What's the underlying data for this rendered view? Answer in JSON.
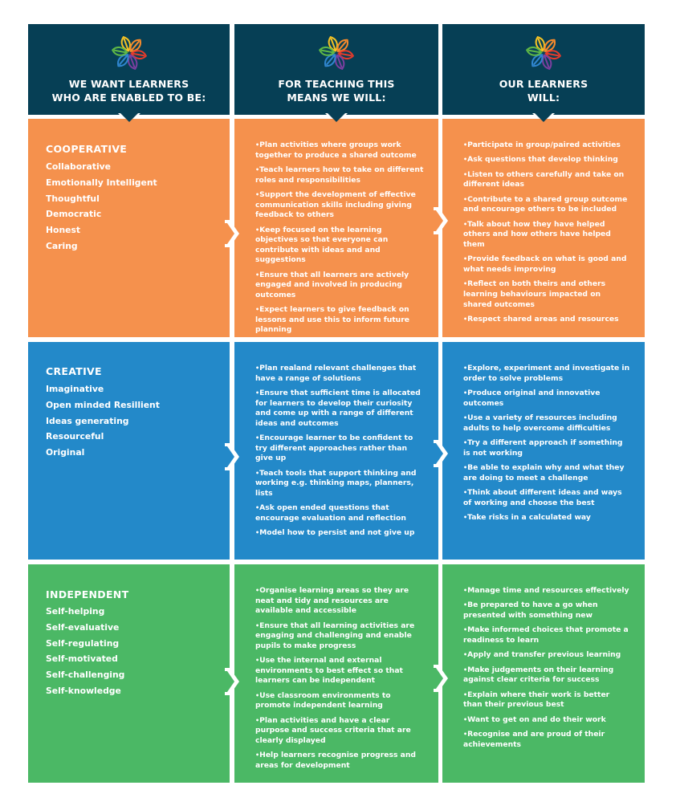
{
  "headers": [
    {
      "title": "WE WANT LEARNERS\nWHO ARE ENABLED TO BE:",
      "icon": "leaf-wreath-logo-icon"
    },
    {
      "title": "FOR TEACHING THIS\nMEANS WE WILL:",
      "icon": "leaf-wreath-logo-icon"
    },
    {
      "title": "OUR LEARNERS\nWILL:",
      "icon": "leaf-wreath-logo-icon"
    }
  ],
  "colors": {
    "header": "#063f55",
    "cooperative": "#f5914d",
    "creative": "#2389c9",
    "independent": "#4bb865",
    "logo_leaves": [
      "#f5c324",
      "#f58a2c",
      "#e53b2c",
      "#7b3fa0",
      "#2f86cf",
      "#5fb846"
    ]
  },
  "rows": [
    {
      "quality": "COOPERATIVE",
      "traits": [
        "Collaborative",
        "Emotionally Intelligent",
        "Thoughtful",
        "Democratic",
        "Honest",
        "Caring"
      ],
      "teaching": [
        "Plan activities where groups work together to produce a shared outcome",
        "Teach learners how to take on different roles and responsibilities",
        "Support the development of effective communication skills including giving feedback to others",
        "Keep focused on the learning objectives so that everyone can contribute with ideas and and suggestions",
        "Ensure that all learners are actively engaged and involved in producing outcomes",
        "Expect learners to give feedback on lessons and use this to inform future planning"
      ],
      "learners": [
        "Participate in group/paired activities",
        "Ask questions that develop thinking",
        "Listen to others carefully and take on different ideas",
        "Contribute to a shared group outcome and encourage others to be included",
        "Talk about how they have helped others and how others have helped them",
        "Provide feedback on what is good and what needs improving",
        "Reflect on both theirs and others learning behaviours impacted on shared outcomes",
        "Respect shared areas and resources"
      ]
    },
    {
      "quality": "CREATIVE",
      "traits": [
        "Imaginative",
        "Open minded Resillient",
        "Ideas generating",
        "Resourceful",
        "Original"
      ],
      "teaching": [
        "Plan realand relevant challenges that have a range of solutions",
        "Ensure that sufficient time is allocated for learners to develop their curiosity and come up with a range of different ideas and outcomes",
        "Encourage learner to be confident to try different approaches rather than give up",
        "Teach tools that support thinking and working e.g. thinking maps, planners, lists",
        "Ask open ended questions that encourage evaluation and reflection",
        "Model how to persist and not give up"
      ],
      "learners": [
        "Explore, experiment and investigate in order to solve problems",
        "Produce original and innovative outcomes",
        "Use a variety of resources including adults to help overcome difficulties",
        "Try a different approach if something is not working",
        "Be able to explain why and what they are doing to meet a challenge",
        "Think about different ideas and ways of working and choose the best",
        "Take risks in a calculated way"
      ]
    },
    {
      "quality": "INDEPENDENT",
      "traits": [
        "Self-helping",
        "Self-evaluative",
        "Self-regulating",
        "Self-motivated",
        "Self-challenging",
        "Self-knowledge"
      ],
      "teaching": [
        "Organise learning areas so they are neat and tidy and resources are available and accessible",
        "Ensure that all learning activities are engaging and challenging and enable pupils to make progress",
        "Use the internal and external environments to best effect so that learners can be independent",
        "Use classroom environments to promote independent learning",
        "Plan activities and have a clear purpose and success criteria that are clearly displayed",
        "Help learners recognise progress and areas for development"
      ],
      "learners": [
        "Manage time and resources effectively",
        "Be prepared to have a go when presented with something new",
        "Make informed choices that promote a readiness to learn",
        "Apply and transfer previous learning",
        "Make judgements on their learning against clear criteria for success",
        "Explain where their work is better than their previous best",
        "Want to get on and do their work",
        "Recognise and are proud of their achievements"
      ]
    }
  ]
}
